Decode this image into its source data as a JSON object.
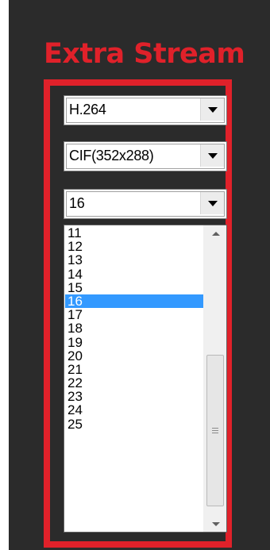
{
  "panel": {
    "title": "Extra Stream"
  },
  "codec_select": {
    "value": "H.264"
  },
  "resolution_select": {
    "value": "CIF(352x288)"
  },
  "framerate_select": {
    "value": "16",
    "options": [
      "11",
      "12",
      "13",
      "14",
      "15",
      "16",
      "17",
      "18",
      "19",
      "20",
      "21",
      "22",
      "23",
      "24",
      "25"
    ],
    "selected_index": 5
  },
  "colors": {
    "highlight": "#e0212a",
    "selection": "#3399ff",
    "panel_background": "#2b2b2b"
  },
  "icons": {
    "dropdown": "chevron-down-icon",
    "scroll_up": "scroll-up-arrow-icon",
    "scroll_down": "scroll-down-arrow-icon"
  }
}
